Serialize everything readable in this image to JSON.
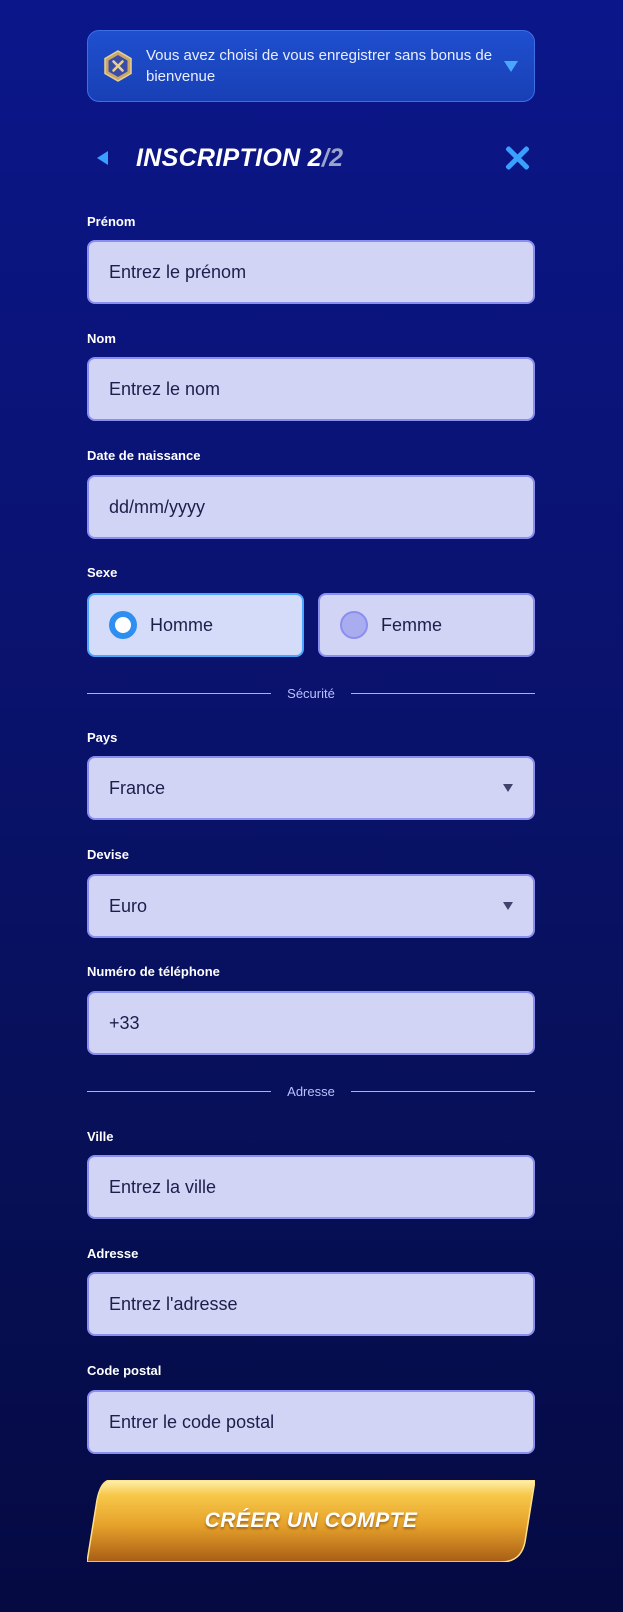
{
  "banner": {
    "text": "Vous avez choisi de vous enregistrer sans bonus de bienvenue",
    "icon": "bonus-declined-icon",
    "caret_icon": "caret-down-icon"
  },
  "header": {
    "title": "INSCRIPTION 2",
    "title_suffix": "/2",
    "back_icon": "back-arrow-icon",
    "close_icon": "close-icon"
  },
  "form": {
    "first_name": {
      "label": "Prénom",
      "placeholder": "Entrez le prénom"
    },
    "last_name": {
      "label": "Nom",
      "placeholder": "Entrez le nom"
    },
    "birth_date": {
      "label": "Date de naissance",
      "placeholder": "dd/mm/yyyy"
    },
    "gender": {
      "label": "Sexe",
      "options": [
        "Homme",
        "Femme"
      ],
      "selected": "Homme"
    },
    "security_divider": "Sécurité",
    "country": {
      "label": "Pays",
      "value": "France"
    },
    "currency": {
      "label": "Devise",
      "value": "Euro"
    },
    "phone": {
      "label": "Numéro de téléphone",
      "value": "+33"
    },
    "address_divider": "Adresse",
    "city": {
      "label": "Ville",
      "placeholder": "Entrez la ville"
    },
    "address": {
      "label": "Adresse",
      "placeholder": "Entrez l'adresse"
    },
    "postal_code": {
      "label": "Code postal",
      "placeholder": "Entrer le code postal"
    }
  },
  "cta": {
    "label": "CRÉER UN COMPTE"
  },
  "colors": {
    "background": "#0a1372",
    "field_bg": "#d2d4f6",
    "field_border": "#8a8ef0",
    "accent": "#3aa0ff",
    "cta_gold": "#f0b030"
  }
}
